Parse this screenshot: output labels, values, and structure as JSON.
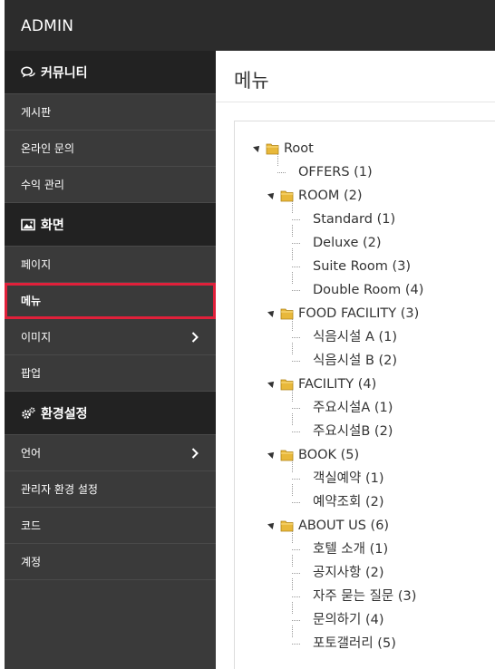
{
  "app": {
    "title": "ADMIN"
  },
  "sidebar": {
    "sections": [
      {
        "label": "커뮤니티",
        "icon": "chat-icon",
        "items": [
          {
            "label": "게시판"
          },
          {
            "label": "온라인 문의"
          },
          {
            "label": "수익 관리"
          }
        ]
      },
      {
        "label": "화면",
        "icon": "image-icon",
        "items": [
          {
            "label": "페이지"
          },
          {
            "label": "메뉴",
            "active": true
          },
          {
            "label": "이미지",
            "expandable": true
          },
          {
            "label": "팝업"
          }
        ]
      },
      {
        "label": "환경설정",
        "icon": "gears-icon",
        "items": [
          {
            "label": "언어",
            "expandable": true
          },
          {
            "label": "관리자 환경 설정"
          },
          {
            "label": "코드"
          },
          {
            "label": "계정"
          }
        ]
      }
    ]
  },
  "main": {
    "title": "메뉴",
    "tree": {
      "root": "Root",
      "nodes": [
        {
          "label": "OFFERS (1)",
          "children": []
        },
        {
          "label": "ROOM (2)",
          "children": [
            "Standard (1)",
            "Deluxe (2)",
            "Suite Room (3)",
            "Double Room (4)"
          ]
        },
        {
          "label": "FOOD FACILITY (3)",
          "children": [
            "식음시설 A (1)",
            "식음시설 B (2)"
          ]
        },
        {
          "label": "FACILITY (4)",
          "children": [
            "주요시설A (1)",
            "주요시설B (2)"
          ]
        },
        {
          "label": "BOOK (5)",
          "children": [
            "객실예약 (1)",
            "예약조회 (2)"
          ]
        },
        {
          "label": "ABOUT US (6)",
          "children": [
            "호텔 소개 (1)",
            "공지사항 (2)",
            "자주 묻는 질문 (3)",
            "문의하기 (4)",
            "포토갤러리 (5)"
          ]
        }
      ]
    }
  },
  "colors": {
    "topbar": "#2c2c2c",
    "sidebar": "#3a3a3a",
    "section_header": "#222222",
    "active_outline": "#e0203a",
    "folder": "#e8b83a"
  }
}
